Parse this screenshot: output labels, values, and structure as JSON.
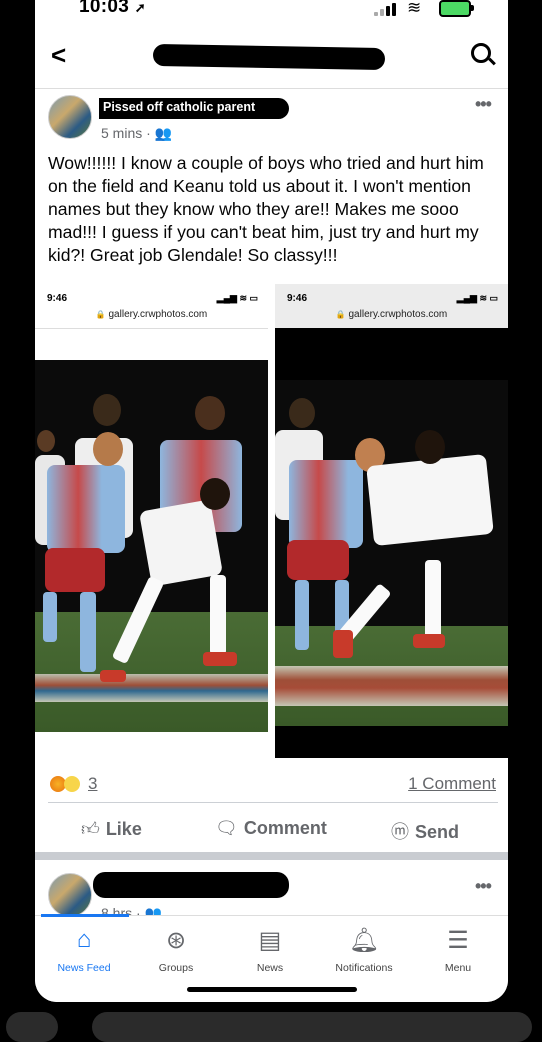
{
  "status_bar": {
    "time": "10:03",
    "location_arrow": "➚"
  },
  "header": {
    "back_icon": "chevron-left-icon",
    "title_redacted": true,
    "search_icon": "search-icon"
  },
  "post": {
    "author": "Pissed off catholic parent",
    "time": "5 mins",
    "audience_icon": "friends-icon",
    "text": "Wow!!!!!!  I know a couple of boys who tried and hurt him on the field and Keanu told us about it. I won't mention names but they know who they are!! Makes me sooo mad!!! I guess if you can't beat him, just try and hurt my kid?!  Great job Glendale! So classy!!!",
    "screenshots": [
      {
        "time": "9:46",
        "url": "gallery.crwphotos.com"
      },
      {
        "time": "9:46",
        "url": "gallery.crwphotos.com"
      }
    ],
    "reaction_count": "3",
    "comment_count": "1 Comment",
    "actions": {
      "like": "Like",
      "comment": "Comment",
      "send": "Send"
    }
  },
  "next_post": {
    "time": "8 hrs"
  },
  "tabbar": {
    "items": [
      {
        "label": "News Feed",
        "icon": "home-icon"
      },
      {
        "label": "Groups",
        "icon": "groups-icon"
      },
      {
        "label": "News",
        "icon": "news-icon"
      },
      {
        "label": "Notifications",
        "icon": "bell-icon"
      },
      {
        "label": "Menu",
        "icon": "menu-icon"
      }
    ]
  },
  "colors": {
    "accent": "#1877f2",
    "text": "#050505",
    "muted": "#65676b"
  }
}
